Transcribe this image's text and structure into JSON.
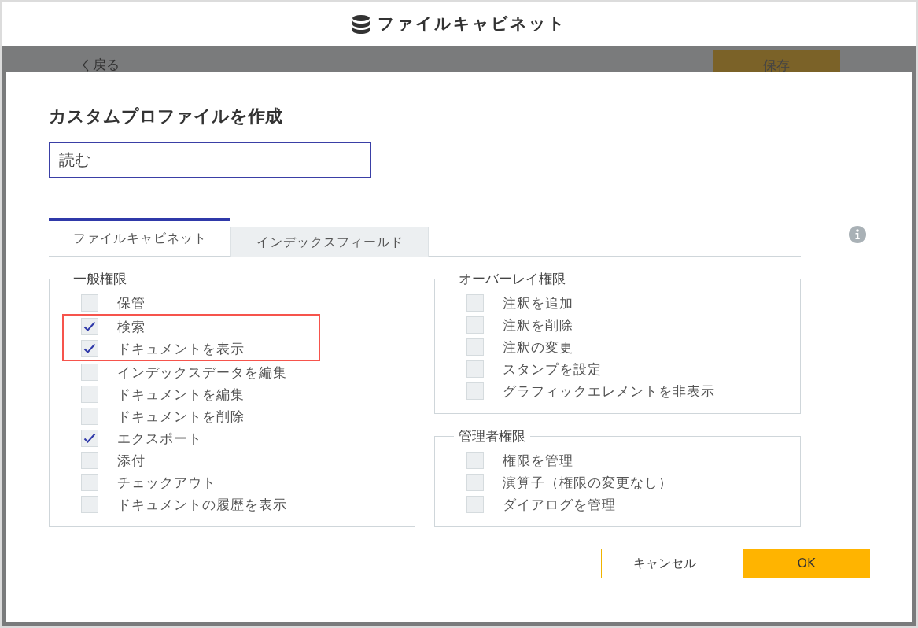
{
  "app_header": {
    "title": "ファイルキャビネット"
  },
  "background_toolbar": {
    "back_link": "く戻る",
    "save_button": "保存"
  },
  "dialog": {
    "title": "カスタムプロファイルを作成",
    "name_field": {
      "value": "読む"
    },
    "tabs": [
      {
        "label": "ファイルキャビネット",
        "selected": true
      },
      {
        "label": "インデックスフィールド",
        "selected": false
      }
    ],
    "left_groups": [
      {
        "legend": "一般権限",
        "items": [
          {
            "label": "保管",
            "checked": false,
            "highlighted": false
          },
          {
            "label": "検索",
            "checked": true,
            "highlighted": true
          },
          {
            "label": "ドキュメントを表示",
            "checked": true,
            "highlighted": true
          },
          {
            "label": "インデックスデータを編集",
            "checked": false,
            "highlighted": false
          },
          {
            "label": "ドキュメントを編集",
            "checked": false,
            "highlighted": false
          },
          {
            "label": "ドキュメントを削除",
            "checked": false,
            "highlighted": false
          },
          {
            "label": "エクスポート",
            "checked": true,
            "highlighted": false
          },
          {
            "label": "添付",
            "checked": false,
            "highlighted": false
          },
          {
            "label": "チェックアウト",
            "checked": false,
            "highlighted": false
          },
          {
            "label": "ドキュメントの履歴を表示",
            "checked": false,
            "highlighted": false
          }
        ]
      }
    ],
    "right_groups": [
      {
        "legend": "オーバーレイ権限",
        "items": [
          {
            "label": "注釈を追加",
            "checked": false,
            "highlighted": false
          },
          {
            "label": "注釈を削除",
            "checked": false,
            "highlighted": false
          },
          {
            "label": "注釈の変更",
            "checked": false,
            "highlighted": false
          },
          {
            "label": "スタンプを設定",
            "checked": false,
            "highlighted": false
          },
          {
            "label": "グラフィックエレメントを非表示",
            "checked": false,
            "highlighted": false
          }
        ]
      },
      {
        "legend": "管理者権限",
        "items": [
          {
            "label": "権限を管理",
            "checked": false,
            "highlighted": false
          },
          {
            "label": "演算子（権限の変更なし）",
            "checked": false,
            "highlighted": false
          },
          {
            "label": "ダイアログを管理",
            "checked": false,
            "highlighted": false
          }
        ]
      }
    ],
    "buttons": [
      {
        "label": "キャンセル",
        "kind": "secondary"
      },
      {
        "label": "OK",
        "kind": "primary"
      }
    ]
  }
}
